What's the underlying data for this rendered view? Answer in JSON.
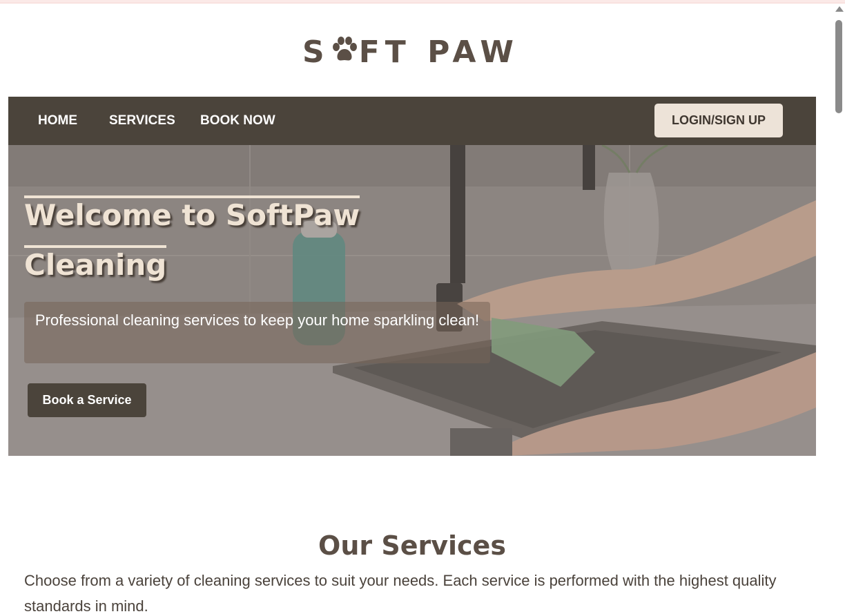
{
  "header": {
    "logo_left": "S",
    "logo_right": "FT PAW",
    "logo_icon": "paw-icon"
  },
  "nav": {
    "items": [
      {
        "label": "HOME"
      },
      {
        "label": "SERVICES"
      },
      {
        "label": "BOOK NOW"
      }
    ],
    "login_label": "LOGIN/SIGN UP"
  },
  "hero": {
    "title_line1": "Welcome to SoftPaw",
    "title_line2": "Cleaning",
    "subtitle": "Professional cleaning services to keep your home sparkling clean!",
    "button_label": "Book a Service"
  },
  "services": {
    "title": "Our Services",
    "description": "Choose from a variety of cleaning services to suit your needs. Each service is performed with the highest quality standards in mind."
  },
  "colors": {
    "brand_dark": "#4b443b",
    "logo_text": "#5b4f46",
    "login_bg": "#ede3d8",
    "title_text": "#efe3d4"
  }
}
